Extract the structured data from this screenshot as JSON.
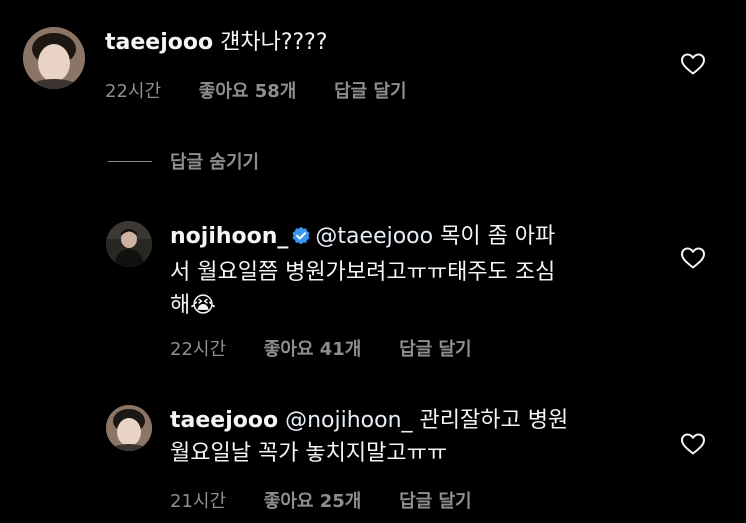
{
  "comments": [
    {
      "username": "taeejooo",
      "text": "걘차나????",
      "time": "22시간",
      "likes": "좋아요 58개",
      "reply": "답글 달기"
    },
    {
      "username": "nojihoon_",
      "verified": true,
      "mention": "@taeejooo",
      "text_line1": "목이 좀 아파",
      "text_line2": "서 월요일쯤 병원가보려고ㅠㅠ태주도 조심",
      "text_line3": "해",
      "emoji": "😭",
      "time": "22시간",
      "likes": "좋아요 41개",
      "reply": "답글 달기"
    },
    {
      "username": "taeejooo",
      "mention": "@nojihoon_",
      "text_line1": "관리잘하고 병원",
      "text_line2": "월요일날 꼭가 놓치지말고ㅠㅠ",
      "time": "21시간",
      "likes": "좋아요 25개",
      "reply": "답글 달기"
    }
  ],
  "hide_replies": "답글 숨기기",
  "colors": {
    "background": "#000000",
    "primary_text": "#f5f5f5",
    "secondary_text": "#8e8e8e",
    "verified_badge": "#3897f0"
  }
}
